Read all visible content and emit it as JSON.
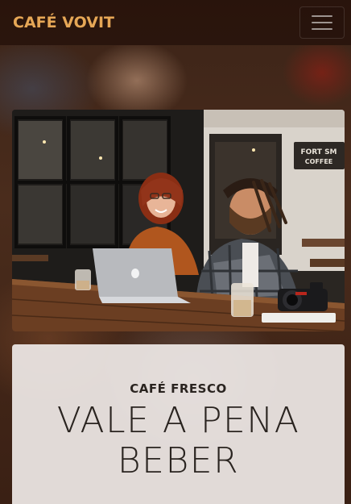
{
  "navbar": {
    "brand": "CAFÉ VOVIT",
    "menu_icon": "hamburger-menu-icon"
  },
  "hero": {
    "image": "photo-of-two-people-at-cafe-table-with-laptop-and-camera"
  },
  "intro": {
    "subheading": "CAFÉ FRESCO",
    "heading_line1": "VALE A PENA",
    "heading_line2": "BEBER"
  },
  "colors": {
    "brand": "#e6a756",
    "navbar_bg": "#28140c",
    "card_bg": "#eee8e6",
    "text_dark": "#2a2420"
  }
}
